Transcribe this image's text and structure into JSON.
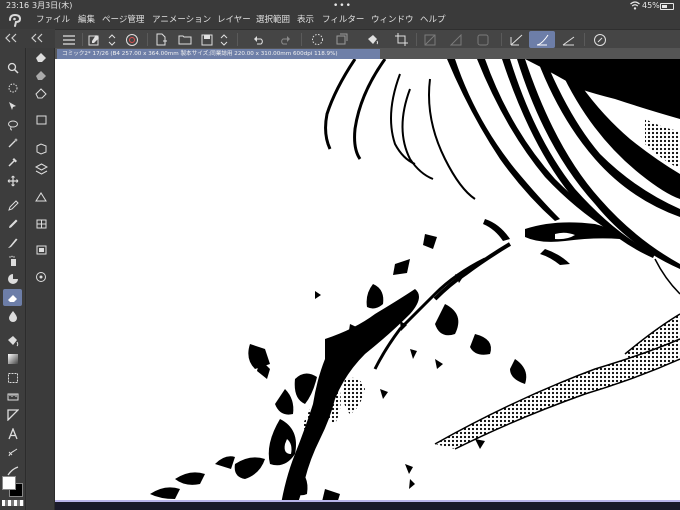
{
  "status": {
    "time": "23:16",
    "date": "3月3日(木)",
    "more_dots": "•••",
    "battery_text": "45%"
  },
  "menu": {
    "items": [
      "ファイル",
      "編集",
      "ページ管理",
      "アニメーション",
      "レイヤー",
      "選択範囲",
      "表示",
      "フィルター",
      "ウィンドウ",
      "ヘルプ"
    ]
  },
  "document": {
    "tab_title": "コミック2* 17/26 (B4 257.00 x 364.00mm 製本サイズ;同業誌用 220.00 x 310.00mm 600dpi 118.9%)"
  },
  "colors": {
    "accent": "#6d7ea8",
    "bar_bg": "#3a3a3a",
    "main_color": "#ffffff",
    "sub_color": "#000000"
  },
  "icons": {
    "toolbar": [
      "zoom-icon",
      "move-icon",
      "select-icon",
      "lasso-icon",
      "magic-wand-icon",
      "eyedropper-icon",
      "object-icon",
      "pen-icon",
      "pencil-icon",
      "brush-icon",
      "airbrush-icon",
      "blend-icon",
      "eraser-icon",
      "blur-icon",
      "fill-icon",
      "gradient-icon",
      "frame-icon",
      "ruler-icon",
      "shape-icon",
      "text-icon",
      "balloon-icon",
      "correct-line-icon"
    ],
    "subtools": [
      "eraser-hard-icon",
      "eraser-soft-icon",
      "eraser-rough-icon",
      "layer-eraser-icon",
      "vector-eraser-icon",
      "eraser-stack-icon",
      "eraser-snap-icon",
      "eraser-pattern-icon",
      "eraser-square-icon",
      "eraser-search-icon"
    ]
  }
}
